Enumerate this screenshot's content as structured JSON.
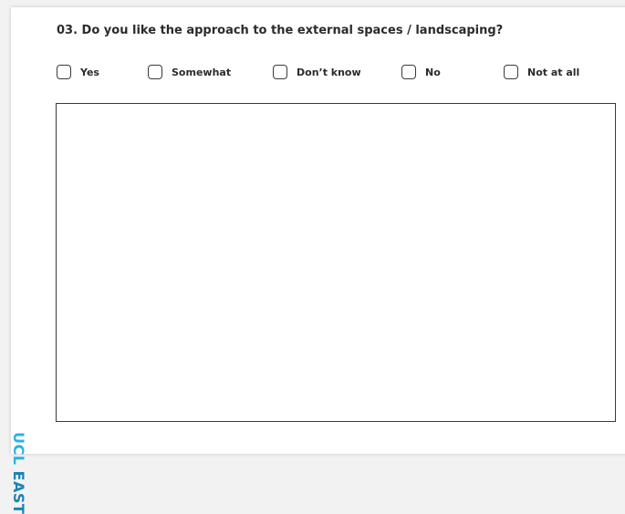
{
  "question": {
    "text": "03. Do you like the approach to the external spaces / landscaping?"
  },
  "options": [
    {
      "label": "Yes"
    },
    {
      "label": "Somewhat"
    },
    {
      "label": "Don’t know"
    },
    {
      "label": "No"
    },
    {
      "label": "Not at all"
    }
  ],
  "answer_box": {
    "value": ""
  },
  "brand": {
    "ucl": "UCL",
    "east": "EAST",
    "ucl_color": "#2bb1e3",
    "east_color": "#1c83b5"
  }
}
